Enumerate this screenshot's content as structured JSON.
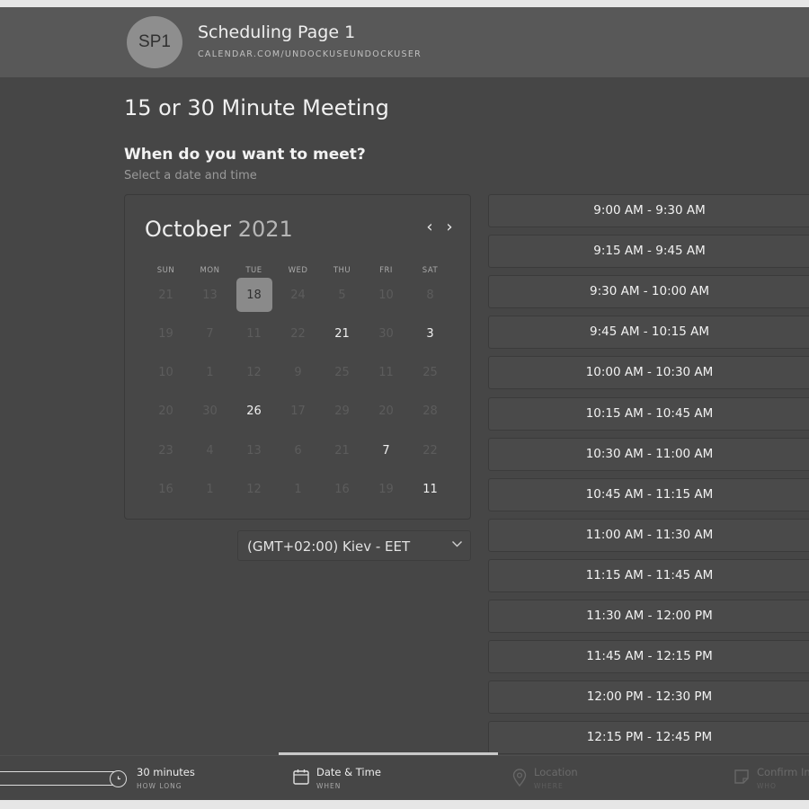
{
  "header": {
    "avatar_initials": "SP1",
    "page_name": "Scheduling Page 1",
    "url": "CALENDAR.COM/UNDOCKUSEUNDOCKUSER"
  },
  "meeting": {
    "title": "15 or 30 Minute Meeting",
    "question": "When do you want to meet?",
    "subtitle": "Select a date and time"
  },
  "calendar": {
    "month": "October",
    "year": "2021",
    "prev_icon": "chevron-left-icon",
    "next_icon": "chevron-right-icon",
    "weekdays": [
      "SUN",
      "MON",
      "TUE",
      "WED",
      "THU",
      "FRI",
      "SAT"
    ],
    "weeks": [
      [
        "21",
        "13",
        "18",
        "24",
        "5",
        "10",
        "8"
      ],
      [
        "19",
        "7",
        "11",
        "22",
        "21",
        "30",
        "3"
      ],
      [
        "10",
        "1",
        "12",
        "9",
        "25",
        "11",
        "25"
      ],
      [
        "20",
        "30",
        "26",
        "17",
        "29",
        "20",
        "28"
      ],
      [
        "23",
        "4",
        "13",
        "6",
        "21",
        "7",
        "22"
      ],
      [
        "16",
        "1",
        "12",
        "1",
        "16",
        "19",
        "11"
      ]
    ],
    "available": [
      {
        "week": 1,
        "day": 4
      },
      {
        "week": 1,
        "day": 6
      },
      {
        "week": 3,
        "day": 2
      },
      {
        "week": 4,
        "day": 5
      },
      {
        "week": 5,
        "day": 6
      }
    ],
    "selected": {
      "week": 0,
      "day": 2,
      "label": "18"
    }
  },
  "timezone": {
    "label": "(GMT+02:00) Kiev - EET",
    "icon": "chevron-down-icon"
  },
  "time_slots": [
    "9:00 AM - 9:30 AM",
    "9:15 AM - 9:45 AM",
    "9:30 AM - 10:00 AM",
    "9:45 AM - 10:15 AM",
    "10:00 AM - 10:30 AM",
    "10:15 AM - 10:45 AM",
    "10:30 AM - 11:00 AM",
    "10:45 AM - 11:15 AM",
    "11:00 AM - 11:30 AM",
    "11:15 AM - 11:45 AM",
    "11:30 AM - 12:00 PM",
    "11:45 AM - 12:15 PM",
    "12:00 PM - 12:30 PM",
    "12:15 PM - 12:45 PM"
  ],
  "footer": {
    "steps": [
      {
        "label": "30 minutes",
        "sublabel": "HOW LONG",
        "icon": "clock-icon",
        "state": "done"
      },
      {
        "label": "Date & Time",
        "sublabel": "WHEN",
        "icon": "calendar-icon",
        "state": "active"
      },
      {
        "label": "Location",
        "sublabel": "WHERE",
        "icon": "location-pin-icon",
        "state": "inactive"
      },
      {
        "label": "Confirm Info",
        "sublabel": "WHO",
        "icon": "note-icon",
        "state": "inactive"
      }
    ]
  },
  "colors": {
    "background": "#464646",
    "header": "#585858",
    "selected_day": "#8a8a8a",
    "available_text": "#f0f0f0",
    "unavailable_text": "#5c5c5c"
  }
}
